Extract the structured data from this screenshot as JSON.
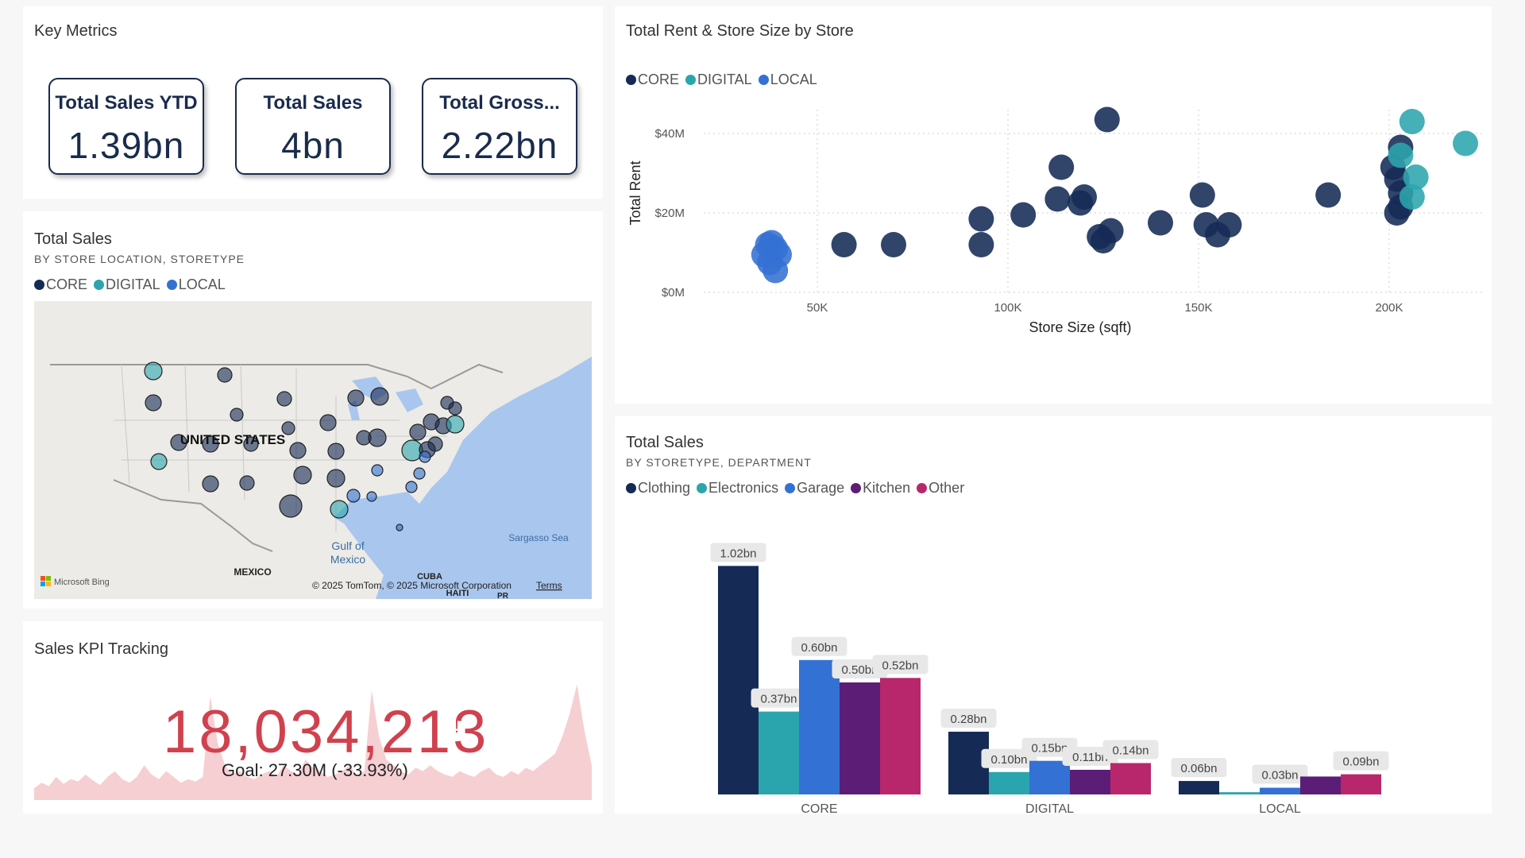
{
  "colors": {
    "core": "#152a55",
    "digital": "#2ba5ad",
    "local": "#3471d4",
    "clothing": "#152a55",
    "electronics": "#2ba5ad",
    "garage": "#3471d4",
    "kitchen": "#5c1d76",
    "other": "#b8276b",
    "kpi": "#d0414e"
  },
  "key_metrics": {
    "title": "Key Metrics",
    "cards": [
      {
        "label": "Total Sales YTD",
        "value": "1.39bn"
      },
      {
        "label": "Total Sales",
        "value": "4bn"
      },
      {
        "label": "Total Gross...",
        "value": "2.22bn"
      }
    ]
  },
  "map_panel": {
    "title": "Total Sales",
    "subtitle": "BY STORE LOCATION, STORETYPE",
    "legend": [
      "CORE",
      "DIGITAL",
      "LOCAL"
    ],
    "labels": {
      "country": "UNITED STATES",
      "gulf": "Gulf of Mexico",
      "mexico": "MEXICO",
      "cuba": "CUBA",
      "haiti": "HAITI",
      "pr": "PR",
      "sargasso": "Sargasso Sea",
      "bing": "Microsoft Bing",
      "copyright": "© 2025 TomTom, © 2025 Microsoft Corporation",
      "terms": "Terms"
    }
  },
  "kpi": {
    "title": "Sales KPI Tracking",
    "value": "18,034,213",
    "indicator": "!",
    "goal": "Goal: 27.30M (-33.93%)",
    "trend": [
      0.1,
      0.15,
      0.12,
      0.2,
      0.14,
      0.18,
      0.16,
      0.22,
      0.17,
      0.13,
      0.2,
      0.25,
      0.18,
      0.15,
      0.2,
      0.3,
      0.22,
      0.18,
      0.25,
      0.2,
      0.15,
      0.18,
      0.16,
      0.2,
      0.9,
      0.5,
      0.3,
      0.22,
      0.25,
      0.2,
      0.18,
      0.22,
      0.25,
      0.2,
      0.3,
      0.25,
      0.22,
      0.35,
      0.28,
      0.25,
      0.2,
      0.22,
      0.25,
      0.3,
      0.2,
      0.25,
      0.95,
      0.55,
      0.35,
      0.3,
      0.25,
      0.22,
      0.28,
      0.25,
      0.3,
      0.25,
      0.22,
      0.2,
      0.25,
      0.22,
      0.2,
      0.25,
      0.28,
      0.22,
      0.2,
      0.25,
      0.22,
      0.28,
      0.25,
      0.3,
      0.35,
      0.4,
      0.55,
      0.75,
      1.0,
      0.6,
      0.3
    ]
  },
  "chart_data": [
    {
      "type": "scatter",
      "title": "Total Rent & Store Size by Store",
      "xlabel": "Store Size (sqft)",
      "ylabel": "Total Rent",
      "xlim": [
        25000,
        220000
      ],
      "ylim": [
        0,
        50000000
      ],
      "xticks": [
        50000,
        100000,
        150000,
        200000
      ],
      "xtick_labels": [
        "50K",
        "100K",
        "150K",
        "200K"
      ],
      "yticks": [
        0,
        20000000,
        40000000
      ],
      "ytick_labels": [
        "$0M",
        "$20M",
        "$40M"
      ],
      "legend": "top-left",
      "grid": true,
      "series": [
        {
          "name": "CORE",
          "points": [
            [
              126000,
              43500000
            ],
            [
              114000,
              31500000
            ],
            [
              113000,
              23500000
            ],
            [
              120000,
              24000000
            ],
            [
              119000,
              22500000
            ],
            [
              104000,
              19500000
            ],
            [
              93000,
              18500000
            ],
            [
              93000,
              12000000
            ],
            [
              57000,
              12000000
            ],
            [
              70000,
              12000000
            ],
            [
              124000,
              14000000
            ],
            [
              127000,
              15500000
            ],
            [
              125000,
              13000000
            ],
            [
              140000,
              17500000
            ],
            [
              151000,
              24500000
            ],
            [
              152000,
              17000000
            ],
            [
              155000,
              14500000
            ],
            [
              158000,
              17000000
            ],
            [
              184000,
              24500000
            ],
            [
              203000,
              36500000
            ],
            [
              201000,
              31500000
            ],
            [
              202000,
              28500000
            ],
            [
              203000,
              25000000
            ],
            [
              202000,
              20000000
            ],
            [
              203000,
              21500000
            ]
          ]
        },
        {
          "name": "DIGITAL",
          "points": [
            [
              206000,
              43000000
            ],
            [
              220000,
              37500000
            ],
            [
              203000,
              34500000
            ],
            [
              207000,
              29000000
            ],
            [
              206000,
              24000000
            ]
          ]
        },
        {
          "name": "LOCAL",
          "points": [
            [
              37000,
              12000000
            ],
            [
              38000,
              12500000
            ],
            [
              39000,
              11000000
            ],
            [
              36000,
              9500000
            ],
            [
              40000,
              9500000
            ],
            [
              37500,
              7500000
            ],
            [
              39000,
              5500000
            ]
          ]
        }
      ]
    },
    {
      "type": "bar",
      "title": "Total Sales",
      "subtitle": "BY STORETYPE, DEPARTMENT",
      "categories": [
        "CORE",
        "DIGITAL",
        "LOCAL"
      ],
      "ylim": [
        0,
        1.1
      ],
      "legend": "top-left",
      "series": [
        {
          "name": "Clothing",
          "values": [
            1.02,
            0.28,
            0.06
          ],
          "labels": [
            "1.02bn",
            "0.28bn",
            "0.06bn"
          ]
        },
        {
          "name": "Electronics",
          "values": [
            0.37,
            0.1,
            0.01
          ],
          "labels": [
            "0.37bn",
            "0.10bn",
            ""
          ]
        },
        {
          "name": "Garage",
          "values": [
            0.6,
            0.15,
            0.03
          ],
          "labels": [
            "0.60bn",
            "0.15bn",
            "0.03bn"
          ]
        },
        {
          "name": "Kitchen",
          "values": [
            0.5,
            0.11,
            0.08
          ],
          "labels": [
            "0.50bn",
            "0.11bn",
            ""
          ]
        },
        {
          "name": "Other",
          "values": [
            0.52,
            0.14,
            0.09
          ],
          "labels": [
            "0.52bn",
            "0.14bn",
            "0.09bn"
          ]
        }
      ]
    }
  ]
}
